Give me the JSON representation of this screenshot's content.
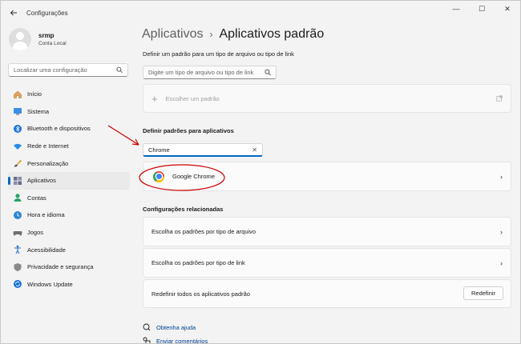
{
  "window": {
    "title": "Configurações",
    "back_icon": "back-arrow-icon",
    "minimize": "—",
    "maximize": "☐",
    "close": "✕"
  },
  "profile": {
    "name": "srmp",
    "account": "Conta Local"
  },
  "sidebar_search": {
    "placeholder": "Localizar uma configuração"
  },
  "nav": {
    "items": [
      {
        "label": "Início",
        "icon": "home-icon"
      },
      {
        "label": "Sistema",
        "icon": "system-icon"
      },
      {
        "label": "Bluetooth e dispositivos",
        "icon": "bluetooth-icon"
      },
      {
        "label": "Rede e Internet",
        "icon": "wifi-icon"
      },
      {
        "label": "Personalização",
        "icon": "brush-icon"
      },
      {
        "label": "Aplicativos",
        "icon": "apps-icon",
        "active": true
      },
      {
        "label": "Contas",
        "icon": "person-icon"
      },
      {
        "label": "Hora e idioma",
        "icon": "globe-clock-icon"
      },
      {
        "label": "Jogos",
        "icon": "gamepad-icon"
      },
      {
        "label": "Acessibilidade",
        "icon": "accessibility-icon"
      },
      {
        "label": "Privacidade e segurança",
        "icon": "shield-icon"
      },
      {
        "label": "Windows Update",
        "icon": "update-icon"
      }
    ]
  },
  "header": {
    "parent": "Aplicativos",
    "separator": "›",
    "current": "Aplicativos padrão"
  },
  "file_type_section": {
    "label": "Definir um padrão para um tipo de arquivo ou tipo de link",
    "placeholder": "Digite um tipo de arquivo ou tipo de link",
    "choose_default": "Escolher um padrão"
  },
  "apps_section": {
    "label": "Definir padrões para aplicativos",
    "search_value": "Chrome",
    "result": "Google Chrome"
  },
  "related": {
    "label": "Configurações relacionadas",
    "items": [
      "Escolha os padrões por tipo de arquivo",
      "Escolha os padrões por tipo de link"
    ],
    "reset_label": "Redefinir todos os aplicativos padrão",
    "reset_button": "Redefinir"
  },
  "footer_links": {
    "help": "Obtenha ajuda",
    "feedback": "Enviar comentários"
  },
  "colors": {
    "accent": "#0067c0",
    "annotation": "#cc0000"
  }
}
